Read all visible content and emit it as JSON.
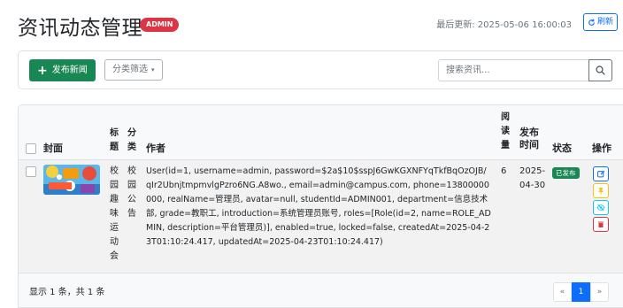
{
  "header": {
    "title": "资讯动态管理",
    "role_badge": "ADMIN",
    "last_updated": "最后更新: 2025-05-06 16:00:03",
    "refresh_label": "刷新"
  },
  "toolbar": {
    "publish_label": "发布新闻",
    "filter_label": "分类筛选",
    "search_placeholder": "搜索资讯..."
  },
  "table": {
    "columns": {
      "cover": "封面",
      "title": "标题",
      "category": "分类",
      "author": "作者",
      "reads": "阅读量",
      "publish_time": "发布时间",
      "status": "状态",
      "actions": "操作"
    },
    "rows": [
      {
        "title": "校园趣味运动会",
        "category": "校园公告",
        "author": "User(id=1, username=admin, password=$2a$10$sspJ6GwKGXNFYqTkfBqOzOJB/qIr2UbnjtmpmvlgPzro6NG.A8wo., email=admin@campus.com, phone=13800000000, realName=管理员, avatar=null, studentId=ADMIN001, department=信息技术部, grade=教职工, introduction=系统管理员账号, roles=[Role(id=2, name=ROLE_ADMIN, description=平台管理员)], enabled=true, locked=false, createdAt=2025-04-23T01:10:24.417, updatedAt=2025-04-23T01:10:24.417)",
        "reads": "6",
        "publish_time": "2025-04-30",
        "status": "已发布"
      }
    ]
  },
  "footer": {
    "summary": "显示 1 条，共 1 条",
    "pagination": {
      "prev": "«",
      "current": "1",
      "next": "»"
    }
  },
  "colors": {
    "primary": "#0d6efd",
    "success": "#198754",
    "danger": "#dc3545",
    "warning": "#ffc107",
    "info": "#0dcaf0"
  }
}
